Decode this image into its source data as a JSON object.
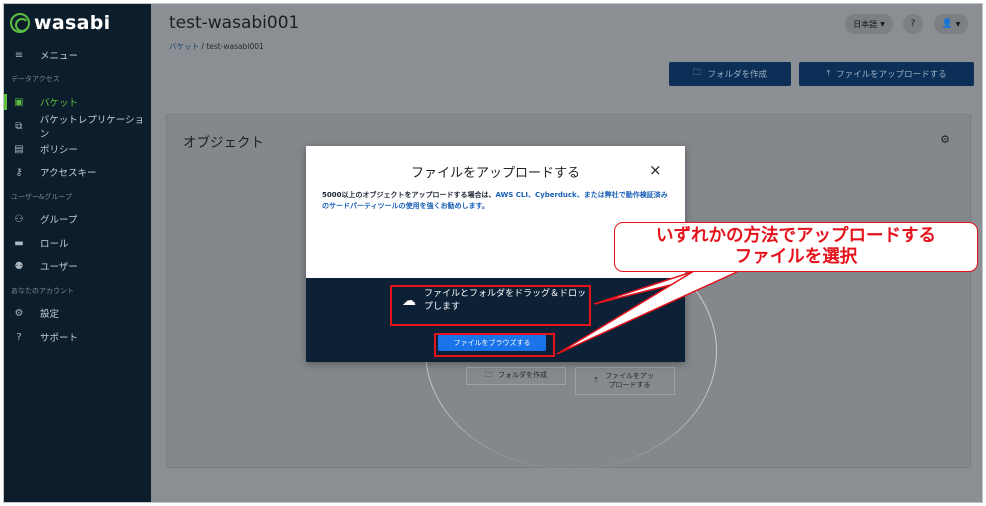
{
  "sidebar": {
    "logo": "wasabi",
    "menu_label": "メニュー",
    "sections": [
      "データアクセス",
      "ユーザー&グループ",
      "あなたのアカウント"
    ],
    "items": [
      {
        "label": "バケット",
        "icon": "bucket-icon",
        "active": true
      },
      {
        "label": "バケットレプリケーション",
        "icon": "replication-icon"
      },
      {
        "label": "ポリシー",
        "icon": "policy-icon"
      },
      {
        "label": "アクセスキー",
        "icon": "key-icon"
      },
      {
        "label": "グループ",
        "icon": "group-icon"
      },
      {
        "label": "ロール",
        "icon": "role-icon"
      },
      {
        "label": "ユーザー",
        "icon": "users-icon"
      },
      {
        "label": "設定",
        "icon": "gear-icon"
      },
      {
        "label": "サポート",
        "icon": "help-icon"
      }
    ],
    "accent": "#5cbf40"
  },
  "header": {
    "title": "test-wasabi001",
    "breadcrumb": {
      "parent": "バケット",
      "separator": "/",
      "current": "test-wasabi001"
    },
    "language": "日本語",
    "create_folder": "フォルダを作成",
    "upload_file": "ファイルをアップロードする"
  },
  "card": {
    "title": "オブジェクト",
    "create_folder": "フォルダを作成",
    "upload_file": "ファイルをアップロードする"
  },
  "modal": {
    "title": "ファイルをアップロードする",
    "close": "×",
    "body_pre": "5000以上のオブジェクトをアップロードする場合は、",
    "body_links": "AWS CLI、Cyberduck、または弊社で動作検証済みのサードパーティツールの使用を強くお勧めします。",
    "drop_text": "ファイルとフォルダをドラッグ＆ドロップします",
    "browse": "ファイルをブラウズする"
  },
  "annotation": {
    "line1": "いずれかの方法でアップロードする",
    "line2": "ファイルを選択",
    "color": "#e5121b"
  }
}
